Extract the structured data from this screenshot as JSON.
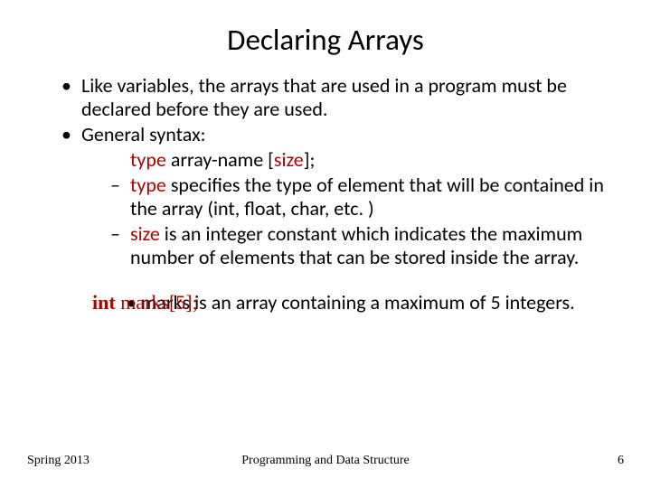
{
  "title": "Declaring Arrays",
  "bullets": {
    "b1a": "Like variables, the arrays that are used in a program must be declared before they are used.",
    "b1b": "General syntax:",
    "syntax_type": "type",
    "syntax_mid": "   array-name [",
    "syntax_size": "size",
    "syntax_end": "];",
    "sub1_lead": "type",
    "sub1_rest": " specifies the type of element that will be contained in the array (int, float, char, etc. )",
    "sub2_lead": "size",
    "sub2_rest": " is an integer constant which indicates the maximum number of elements that can be stored inside the array."
  },
  "example": {
    "kw": "int",
    "arr": "   marks[5];",
    "text": "• marks is an array containing a maximum of 5 integers."
  },
  "footer": {
    "left": "Spring 2013",
    "center": "Programming and Data Structure",
    "right": "6"
  }
}
